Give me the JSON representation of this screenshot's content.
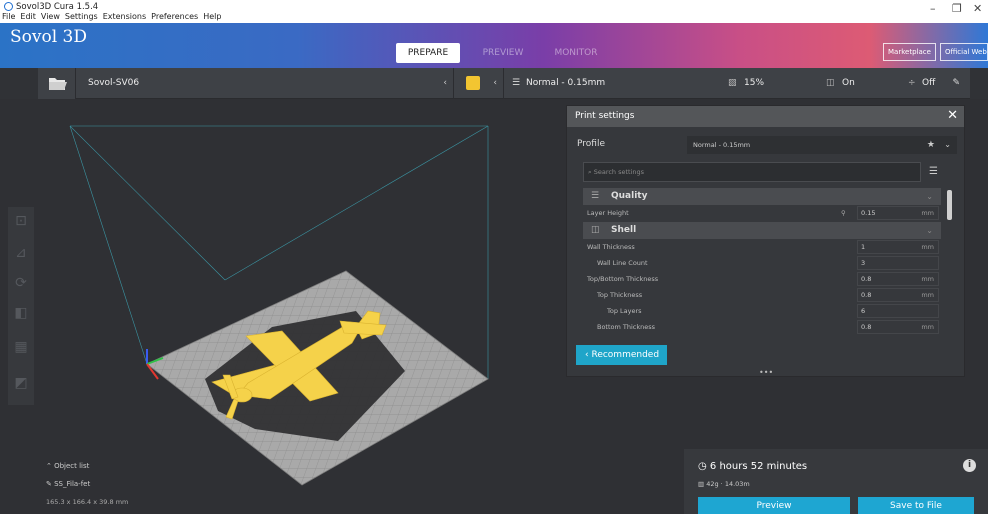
{
  "window": {
    "title": "Sovol3D Cura 1.5.4",
    "menu": [
      "File",
      "Edit",
      "View",
      "Settings",
      "Extensions",
      "Preferences",
      "Help"
    ],
    "controls": [
      "minimize",
      "maximize",
      "close"
    ]
  },
  "header": {
    "brand": "Sovol 3D",
    "tabs": [
      "PREPARE",
      "PREVIEW",
      "MONITOR"
    ],
    "active_tab": "PREPARE",
    "buttons": [
      "Marketplace",
      "Official Website"
    ]
  },
  "toolbar": {
    "printer": "Sovol-SV06",
    "profile": "Normal - 0.15mm",
    "infill": "15%",
    "support": "On",
    "adhesion": "Off"
  },
  "left_tools": [
    "move-tool",
    "scale-tool",
    "rotate-tool",
    "mirror-tool",
    "per-model-settings-tool",
    "support-blocker-tool"
  ],
  "print_settings": {
    "title": "Print settings",
    "profile_label": "Profile",
    "profile_value": "Normal - 0.15mm",
    "search_placeholder": "Search settings",
    "categories": [
      {
        "name": "Quality",
        "rows": [
          {
            "label": "Layer Height",
            "value": "0.15",
            "unit": "mm",
            "indent": 0
          }
        ]
      },
      {
        "name": "Shell",
        "rows": [
          {
            "label": "Wall Thickness",
            "value": "1",
            "unit": "mm",
            "indent": 0
          },
          {
            "label": "Wall Line Count",
            "value": "3",
            "unit": "",
            "indent": 1
          },
          {
            "label": "Top/Bottom Thickness",
            "value": "0.8",
            "unit": "mm",
            "indent": 0
          },
          {
            "label": "Top Thickness",
            "value": "0.8",
            "unit": "mm",
            "indent": 1
          },
          {
            "label": "Top Layers",
            "value": "6",
            "unit": "",
            "indent": 2
          },
          {
            "label": "Bottom Thickness",
            "value": "0.8",
            "unit": "mm",
            "indent": 1
          }
        ]
      }
    ],
    "recommended_label": "Recommended"
  },
  "objects": {
    "list_label": "Object list",
    "name": "SS_Fila-fet",
    "dimensions": "165.3 x 166.4 x 39.8 mm"
  },
  "job": {
    "time": "6 hours 52 minutes",
    "material": "42g · 14.03m",
    "preview_label": "Preview",
    "save_label": "Save to File"
  },
  "colors": {
    "accent": "#1EA6D2",
    "model": "#F5D24A",
    "plate": "#A8A8A8",
    "background": "#2F3034"
  }
}
